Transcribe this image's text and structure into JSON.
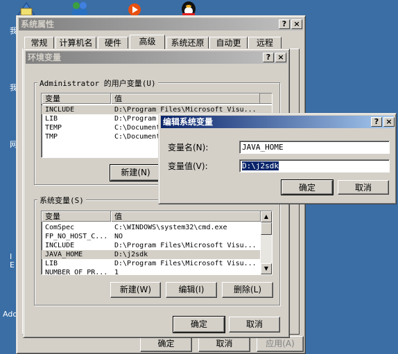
{
  "desktop": {
    "left_labels": [
      "我",
      "我",
      "网",
      "I",
      "E",
      "Ado"
    ]
  },
  "sysprops": {
    "title": "系统属性",
    "help": "?",
    "close": "×",
    "tabs": [
      "常规",
      "计算机名",
      "硬件",
      "高级",
      "系统还原",
      "自动更新",
      "远程"
    ],
    "ok": "确定",
    "cancel": "取消",
    "apply": "应用(A)"
  },
  "envvars": {
    "title": "环境变量",
    "help": "?",
    "close": "×",
    "user_group": "Administrator 的用户变量(U)",
    "col_var": "变量",
    "col_val": "值",
    "user_rows": [
      {
        "name": "INCLUDE",
        "value": "D:\\Program Files\\Microsoft Visu..."
      },
      {
        "name": "LIB",
        "value": "D:\\Program Files\\Microsoft Visu..."
      },
      {
        "name": "TEMP",
        "value": "C:\\Documents and Settings\\Admin..."
      },
      {
        "name": "TMP",
        "value": "C:\\Documents and Settings\\Admin..."
      }
    ],
    "new_user": "新建(N)",
    "sys_group": "系统变量(S)",
    "sys_rows": [
      {
        "name": "ComSpec",
        "value": "C:\\WINDOWS\\system32\\cmd.exe"
      },
      {
        "name": "FP_NO_HOST_C...",
        "value": "NO"
      },
      {
        "name": "INCLUDE",
        "value": "D:\\Program Files\\Microsoft Visu..."
      },
      {
        "name": "JAVA_HOME",
        "value": "D:\\j2sdk"
      },
      {
        "name": "LIB",
        "value": "D:\\Program Files\\Microsoft Visu..."
      },
      {
        "name": "NUMBER_OF_PR...",
        "value": "1"
      }
    ],
    "new_sys": "新建(W)",
    "edit_sys": "编辑(I)",
    "delete_sys": "删除(L)",
    "ok": "确定",
    "cancel": "取消"
  },
  "editdlg": {
    "title": "编辑系统变量",
    "help": "?",
    "close": "×",
    "name_label": "变量名(N):",
    "name_value": "JAVA_HOME",
    "value_label": "变量值(V):",
    "value_value": "D:\\j2sdk",
    "ok": "确定",
    "cancel": "取消"
  }
}
